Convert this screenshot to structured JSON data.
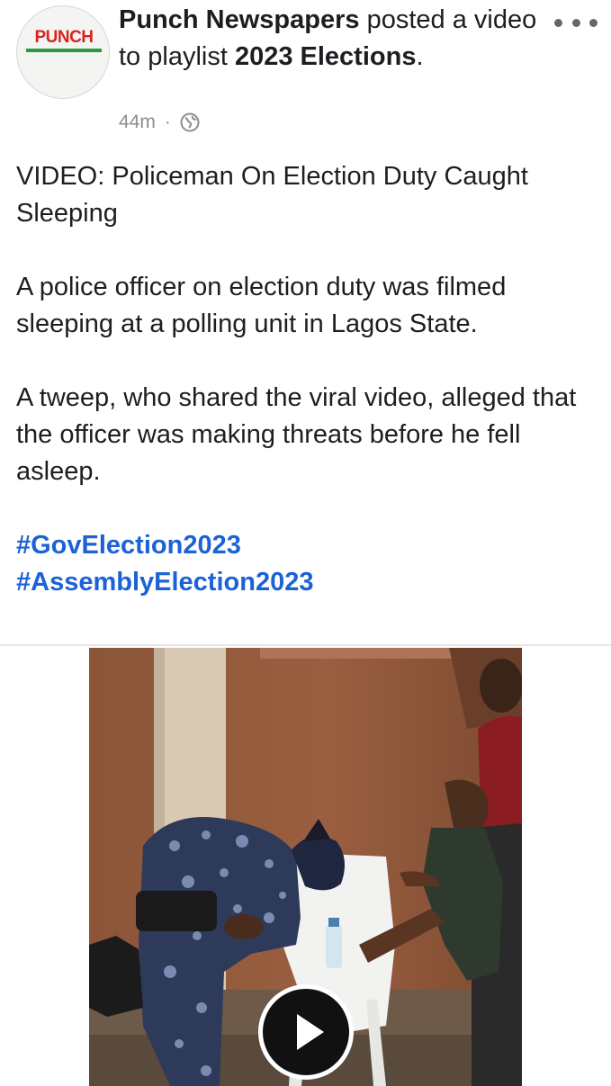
{
  "post": {
    "author": "Punch Newspapers",
    "action": " posted a video to playlist ",
    "playlist": "2023 Elections",
    "end_punct": ".",
    "time": "44m",
    "separator": "·",
    "privacy_icon": "globe-icon",
    "more_icon": "more-horizontal-icon"
  },
  "avatar": {
    "logo_text": "PUNCH",
    "logo_color": "#d9241f",
    "accent_color": "#2e9b3a"
  },
  "body": {
    "paragraphs": [
      "VIDEO: Policeman On Election Duty Caught Sleeping",
      "A police officer on election duty was filmed sleeping at a polling unit in Lagos State.",
      "A tweep, who shared the viral video, alleged that the officer was making threats before he fell asleep."
    ],
    "hashtags": [
      "#GovElection2023",
      "#AssemblyElection2023"
    ],
    "hashtag_color": "#1b62d6"
  },
  "video": {
    "play_icon": "play-icon"
  }
}
